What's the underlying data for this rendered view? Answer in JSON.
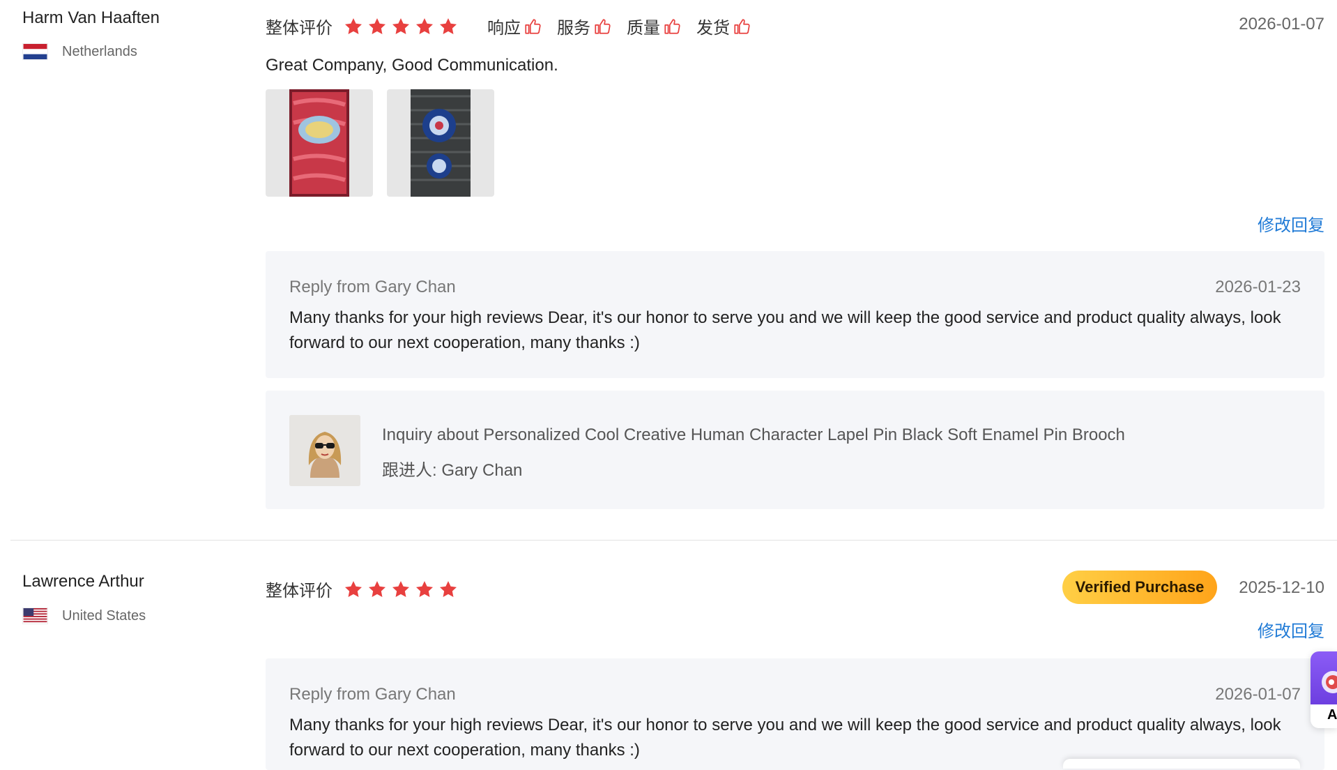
{
  "reviews": [
    {
      "reviewer_name": "Harm Van Haaften",
      "country": "Netherlands",
      "flag": "netherlands-flag",
      "rating_label": "整体评价",
      "stars": 5,
      "sub_ratings": [
        "响应",
        "服务",
        "质量",
        "发货"
      ],
      "date": "2026-01-07",
      "text": "Great Company, Good Communication.",
      "photos": [
        "red-patch-photo",
        "blue-patch-photo"
      ],
      "edit_reply_label": "修改回复",
      "reply": {
        "author": "Reply from Gary Chan",
        "date": "2026-01-23",
        "text": "Many thanks for your high reviews Dear, it's our honor to serve you and we will keep the good service and product quality always, look forward to our next cooperation, many thanks :)"
      },
      "inquiry": {
        "title": "Inquiry about Personalized Cool Creative Human Character Lapel Pin Black Soft Enamel Pin Brooch",
        "follower": "跟进人: Gary Chan"
      }
    },
    {
      "reviewer_name": "Lawrence Arthur",
      "country": "United States",
      "flag": "united-states-flag",
      "rating_label": "整体评价",
      "stars": 5,
      "verified_label": "Verified Purchase",
      "date": "2025-12-10",
      "edit_reply_label": "修改回复",
      "reply": {
        "author": "Reply from Gary Chan",
        "date": "2026-01-07",
        "text": "Many thanks for your high reviews Dear, it's our honor to serve you and we will keep the good service and product quality always, look forward to our next cooperation, many thanks :)"
      }
    }
  ],
  "floating_widget": {
    "letter": "A"
  },
  "colors": {
    "star": "#e8403f",
    "link": "#1f7ad6",
    "reply_bg": "#f5f6f9",
    "badge_start": "#ffcf45",
    "badge_end": "#ffa41a"
  }
}
